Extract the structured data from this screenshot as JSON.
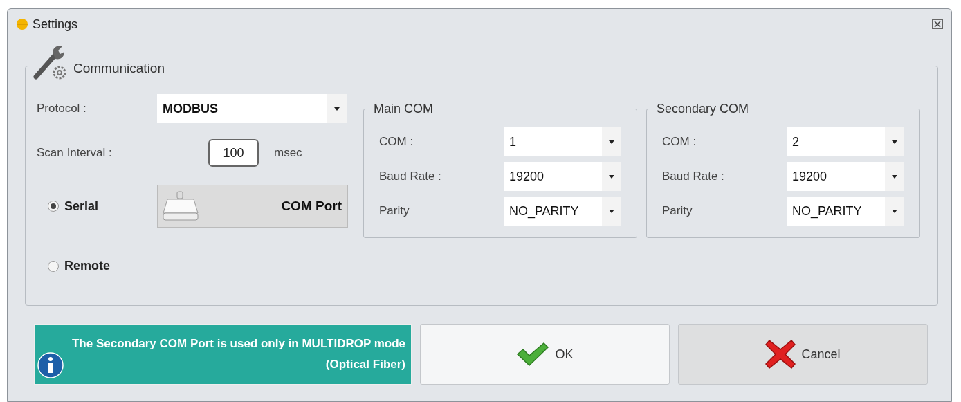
{
  "window": {
    "title": "Settings"
  },
  "communication": {
    "title": "Communication",
    "protocol": {
      "label": "Protocol :",
      "value": "MODBUS"
    },
    "scan_interval": {
      "label": "Scan Interval :",
      "value": "100",
      "unit": "msec"
    },
    "connection_types": [
      {
        "label": "Serial",
        "selected": true
      },
      {
        "label": "Remote",
        "selected": false
      }
    ],
    "port_button": {
      "label": "COM Port"
    },
    "com_groups": [
      {
        "title": "Main COM",
        "fields": [
          {
            "label": "COM :",
            "value": "1"
          },
          {
            "label": "Baud Rate :",
            "value": "19200"
          },
          {
            "label": "Parity",
            "value": "NO_PARITY"
          }
        ]
      },
      {
        "title": "Secondary COM",
        "fields": [
          {
            "label": "COM :",
            "value": "2"
          },
          {
            "label": "Baud Rate :",
            "value": "19200"
          },
          {
            "label": "Parity",
            "value": "NO_PARITY"
          }
        ]
      }
    ]
  },
  "info": {
    "text": "The Secondary COM Port is used only in MULTIDROP mode (Optical Fiber)"
  },
  "buttons": [
    {
      "kind": "ok",
      "label": "OK"
    },
    {
      "kind": "cancel",
      "label": "Cancel"
    }
  ]
}
